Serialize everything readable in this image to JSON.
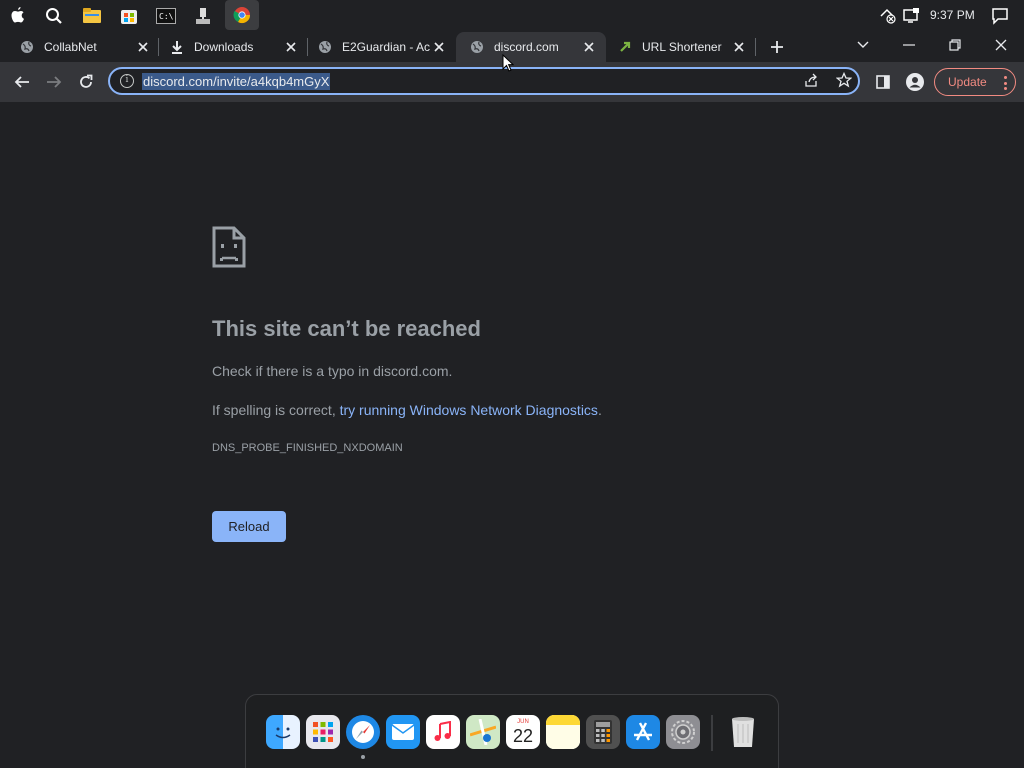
{
  "system": {
    "clock": "9:37 PM"
  },
  "tabs": [
    {
      "title": "CollabNet",
      "icon": "globe-icon"
    },
    {
      "title": "Downloads",
      "icon": "download-icon"
    },
    {
      "title": "E2Guardian - Ac",
      "icon": "globe-icon"
    },
    {
      "title": "discord.com",
      "icon": "globe-icon",
      "active": true
    },
    {
      "title": "URL Shortener, I",
      "icon": "link-icon"
    }
  ],
  "toolbar": {
    "url": "discord.com/invite/a4kqb4mGyX",
    "update_label": "Update"
  },
  "error_page": {
    "title": "This site can’t be reached",
    "line1": "Check if there is a typo in discord.com.",
    "line2_prefix": "If spelling is correct, ",
    "line2_link": "try running Windows Network Diagnostics",
    "line2_suffix": ".",
    "code": "DNS_PROBE_FINISHED_NXDOMAIN",
    "reload_label": "Reload"
  },
  "dock": {
    "calendar_month": "JUN",
    "calendar_day": "22"
  },
  "colors": {
    "background": "#202124",
    "toolbar": "#35363a",
    "accent": "#8ab4f8",
    "update": "#f28b82"
  }
}
